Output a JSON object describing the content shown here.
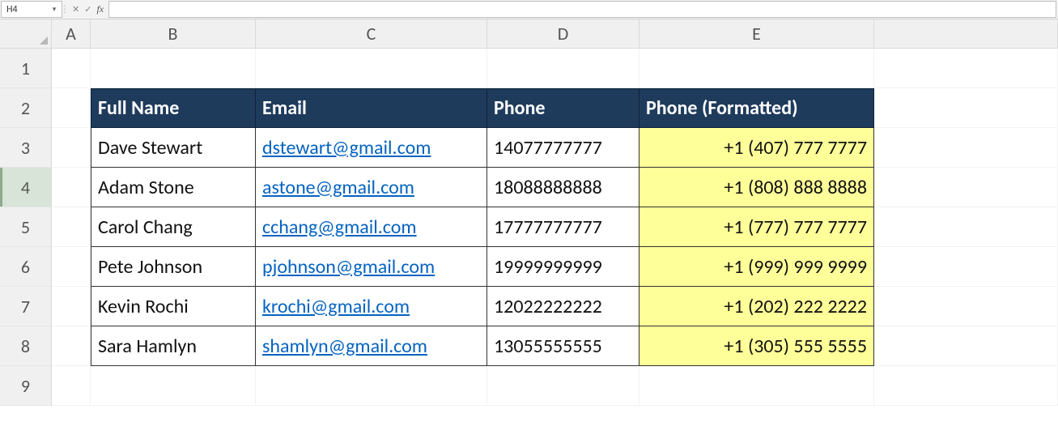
{
  "name_box": "H4",
  "formula": "",
  "columns": [
    "A",
    "B",
    "C",
    "D",
    "E"
  ],
  "row_numbers": [
    "1",
    "2",
    "3",
    "4",
    "5",
    "6",
    "7",
    "8",
    "9"
  ],
  "active_row_index": 3,
  "headers": {
    "name": "Full Name",
    "email": "Email",
    "phone": "Phone",
    "phone_fmt": "Phone (Formatted)"
  },
  "rows": [
    {
      "name": "Dave Stewart",
      "email": "dstewart@gmail.com",
      "phone": "14077777777",
      "phone_fmt": "+1 (407) 777 7777"
    },
    {
      "name": "Adam Stone",
      "email": "astone@gmail.com",
      "phone": "18088888888",
      "phone_fmt": "+1 (808) 888 8888"
    },
    {
      "name": "Carol Chang",
      "email": "cchang@gmail.com",
      "phone": "17777777777",
      "phone_fmt": "+1 (777) 777 7777"
    },
    {
      "name": "Pete Johnson",
      "email": "pjohnson@gmail.com",
      "phone": "19999999999",
      "phone_fmt": "+1 (999) 999 9999"
    },
    {
      "name": "Kevin Rochi",
      "email": "krochi@gmail.com",
      "phone": "12022222222",
      "phone_fmt": "+1 (202) 222 2222"
    },
    {
      "name": "Sara Hamlyn",
      "email": "shamlyn@gmail.com",
      "phone": "13055555555",
      "phone_fmt": "+1 (305) 555 5555"
    }
  ]
}
